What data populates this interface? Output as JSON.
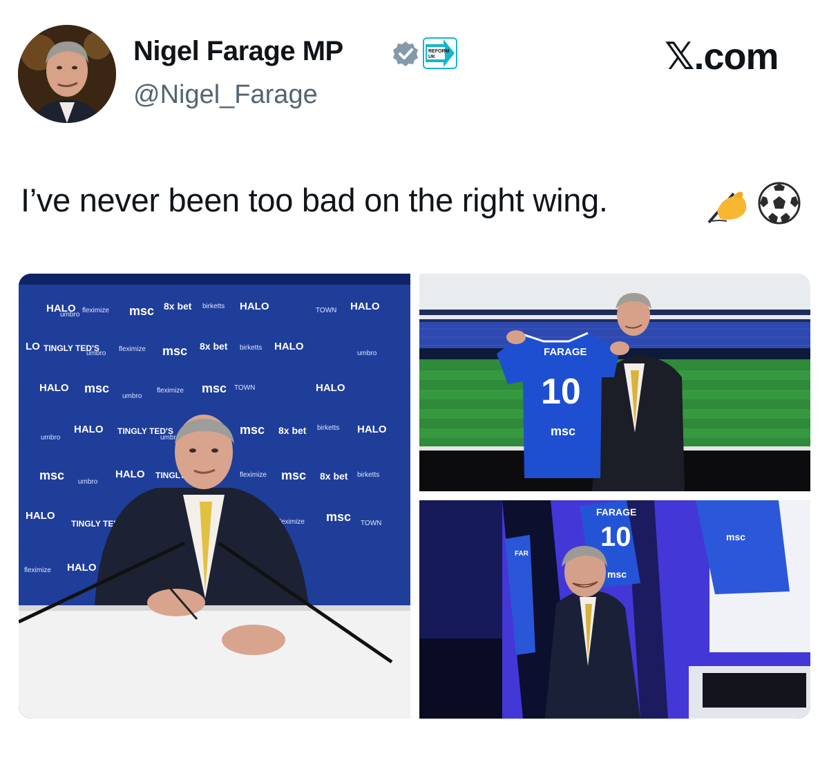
{
  "post": {
    "author_name": "Nigel Farage MP",
    "author_handle": "@Nigel_Farage",
    "party_badge_text_1": "REFORM",
    "party_badge_text_2": "UK",
    "brand": "𝕏.com",
    "text": "I’ve never been too bad on the right wing."
  },
  "emojis": [
    "writing-hand",
    "soccer-ball"
  ],
  "media": {
    "photo_1": {
      "description_icon": "press-conference-photo",
      "board_words": [
        "HALO",
        "TINGLY TED'S",
        "umbro",
        "msc",
        "8x bet",
        "fleximize",
        "birketts",
        "TOWN"
      ]
    },
    "photo_2": {
      "shirt_name": "FARAGE",
      "shirt_number": "10",
      "sponsor": "msc"
    },
    "photo_3": {
      "shirt_name": "FARAGE",
      "shirt_number": "10",
      "sponsor": "msc"
    }
  },
  "colors": {
    "text": "#0f1419",
    "secondary": "#536471",
    "verified": "#829aab",
    "reform": "#12b6cf",
    "ipswich_blue": "#1b47c9"
  }
}
